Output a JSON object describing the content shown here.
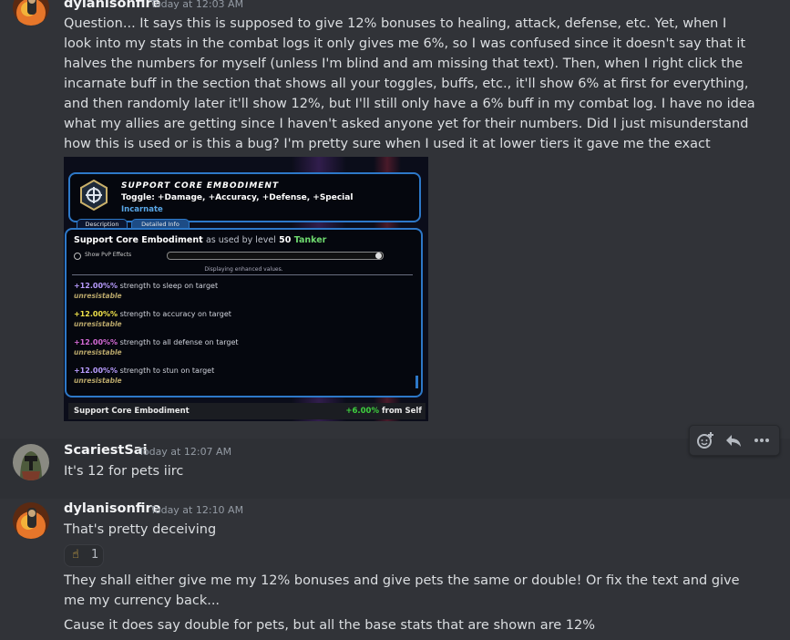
{
  "messages": [
    {
      "author": "dylanisonfire",
      "timestamp": "Today at 12:03 AM",
      "text": "Question... It says this is supposed to give 12% bonuses to healing, attack, defense, etc.  Yet, when I look into my stats in the combat logs it only gives me 6%, so I was confused since it doesn't say that it halves the numbers for myself (unless I'm blind and am missing that text).  Then, when I right click the incarnate buff in the section that shows all your toggles, buffs, etc., it'll show 6% at first for everything, and then randomly later it'll show 12%, but I'll still only have a 6% buff in my combat log.  I have no idea what my allies are getting since I haven't asked anyone yet for their numbers.  Did I just misunderstand how this is used or is this a bug?  I'm pretty sure when I used it at lower tiers it gave me the exact bonuses it said it'd give."
    },
    {
      "author": "ScariestSai",
      "timestamp": "Today at 12:07 AM",
      "text": "It's 12 for pets iirc"
    },
    {
      "author": "dylanisonfire",
      "timestamp": "Today at 12:10 AM",
      "text": "That's pretty deceiving",
      "reaction": {
        "emoji": "☝",
        "count": "1"
      },
      "followups": [
        "They shall either give me my 12% bonuses and give pets the same or double! Or fix the text and give me my currency back...",
        "Cause it does say double for pets, but all the base stats that are shown are 12%"
      ]
    }
  ],
  "game": {
    "power_name": "SUPPORT CORE EMBODIMENT",
    "toggle_line": "Toggle: +Damage, +Accuracy, +Defense, +Special",
    "category": "Incarnate",
    "tabs": [
      "Description",
      "Detailed Info"
    ],
    "detail_title": "Support Core Embodiment",
    "as_used_by": "as used by level",
    "level": "50",
    "archetype": "Tanker",
    "pvp_label": "Show PvP Effects",
    "displaying": "Displaying enhanced values.",
    "effects": [
      {
        "pct": "+12.00%%",
        "desc": " strength to sleep on target",
        "sub": "unresistable",
        "color": "#b99cff"
      },
      {
        "pct": "+12.00%%",
        "desc": " strength to accuracy on target",
        "sub": "unresistable",
        "color": "#f0e24a"
      },
      {
        "pct": "+12.00%%",
        "desc": " strength to all defense on target",
        "sub": "unresistable",
        "color": "#d66ad6"
      },
      {
        "pct": "+12.00%%",
        "desc": " strength to stun on target",
        "sub": "unresistable",
        "color": "#b99cff"
      }
    ],
    "bottom_left": "Support Core Embodiment",
    "bottom_value": "+6.00%",
    "bottom_suffix": " from Self"
  },
  "actions": {
    "add_reaction": "add-reaction",
    "reply": "reply",
    "more": "more"
  },
  "colors": {
    "background": "#313338",
    "username": "#f2f3f5",
    "timestamp": "#949ba4",
    "game_border": "#2d78c8"
  }
}
